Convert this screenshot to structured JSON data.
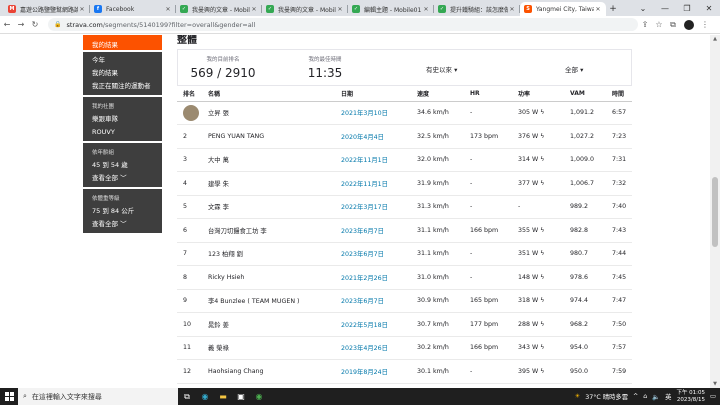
{
  "browser": {
    "tabs": [
      {
        "title": "嘉遊公路鹽鹽幫網路論...",
        "fav": "M",
        "color": "#ea4335",
        "active": false
      },
      {
        "title": "Facebook",
        "fav": "f",
        "color": "#1877f2",
        "active": false
      },
      {
        "title": "我曼興的文章 - Mobile01",
        "fav": "✓",
        "color": "#34a853",
        "active": false
      },
      {
        "title": "我曼興的文章 - Mobile01",
        "fav": "✓",
        "color": "#34a853",
        "active": false
      },
      {
        "title": "編輯主題 - Mobile01",
        "fav": "✓",
        "color": "#34a853",
        "active": false
      },
      {
        "title": "提升鐵騎組：該怎麼做...",
        "fav": "✓",
        "color": "#34a853",
        "active": false
      },
      {
        "title": "Yangmei City, Taiwan ...",
        "fav": "S",
        "color": "#fc5200",
        "active": true
      }
    ],
    "url_host": "strava.com",
    "url_path": "/segments/5140199?filter=overall&gender=all"
  },
  "sidebar": {
    "my_results": "我的結果",
    "sections": [
      {
        "items": [
          "今年",
          "我的結果",
          "我正在關注的運動者"
        ]
      },
      {
        "heading": "我的社團",
        "items": [
          "樂跟車隊",
          "ROUVY"
        ]
      },
      {
        "heading": "依年齡組",
        "items": [
          "45 到 54 歲",
          "查看全部 ﹀"
        ]
      },
      {
        "heading": "依體重等級",
        "items": [
          "75 到 84 公斤",
          "查看全部 ﹀"
        ]
      }
    ]
  },
  "main": {
    "title": "整體",
    "stats": {
      "rank_label": "我的目前排名",
      "rank_value": "569 / 2910",
      "best_label": "我的最佳時間",
      "best_value": "11:35"
    },
    "filter_time": "有史以來 ▾",
    "filter_gender": "全部 ▾"
  },
  "table": {
    "headers": [
      "排名",
      "名稱",
      "日期",
      "速度",
      "HR",
      "功率",
      "VAM",
      "時間"
    ],
    "rows": [
      {
        "rank": "",
        "name": "立昇 張",
        "date": "2021年3月10日",
        "speed": "34.6 km/h",
        "hr": "-",
        "power": "305 W ϟ",
        "vam": "1,091.2",
        "time": "6:57"
      },
      {
        "rank": "2",
        "name": "PENG YUAN TANG",
        "date": "2020年4月4日",
        "speed": "32.5 km/h",
        "hr": "173 bpm",
        "power": "376 W ϟ",
        "vam": "1,027.2",
        "time": "7:23"
      },
      {
        "rank": "3",
        "name": "大中 萬",
        "date": "2022年11月1日",
        "speed": "32.0 km/h",
        "hr": "-",
        "power": "314 W ϟ",
        "vam": "1,009.0",
        "time": "7:31"
      },
      {
        "rank": "4",
        "name": "建學 朱",
        "date": "2022年11月1日",
        "speed": "31.9 km/h",
        "hr": "-",
        "power": "377 W ϟ",
        "vam": "1,006.7",
        "time": "7:32"
      },
      {
        "rank": "5",
        "name": "文霖 李",
        "date": "2022年3月17日",
        "speed": "31.3 km/h",
        "hr": "-",
        "power": "-",
        "vam": "989.2",
        "time": "7:40"
      },
      {
        "rank": "6",
        "name": "台灣刀切饅食工坊 李",
        "date": "2023年6月7日",
        "speed": "31.1 km/h",
        "hr": "166 bpm",
        "power": "355 W ϟ",
        "vam": "982.8",
        "time": "7:43"
      },
      {
        "rank": "7",
        "name": "123 柏翔 劉",
        "date": "2023年6月7日",
        "speed": "31.1 km/h",
        "hr": "-",
        "power": "351 W ϟ",
        "vam": "980.7",
        "time": "7:44"
      },
      {
        "rank": "8",
        "name": "Ricky Hsieh",
        "date": "2021年2月26日",
        "speed": "31.0 km/h",
        "hr": "-",
        "power": "148 W ϟ",
        "vam": "978.6",
        "time": "7:45"
      },
      {
        "rank": "9",
        "name": "李4 Bunzlee ( TEAM MUGEN )",
        "date": "2023年6月7日",
        "speed": "30.9 km/h",
        "hr": "165 bpm",
        "power": "318 W ϟ",
        "vam": "974.4",
        "time": "7:47"
      },
      {
        "rank": "10",
        "name": "晁鈴 姜",
        "date": "2022年5月18日",
        "speed": "30.7 km/h",
        "hr": "177 bpm",
        "power": "288 W ϟ",
        "vam": "968.2",
        "time": "7:50"
      },
      {
        "rank": "11",
        "name": "義 榮祿",
        "date": "2023年4月26日",
        "speed": "30.2 km/h",
        "hr": "166 bpm",
        "power": "343 W ϟ",
        "vam": "954.0",
        "time": "7:57"
      },
      {
        "rank": "12",
        "name": "Haohsiang Chang",
        "date": "2019年8月24日",
        "speed": "30.1 km/h",
        "hr": "-",
        "power": "395 W ϟ",
        "vam": "950.0",
        "time": "7:59"
      }
    ]
  },
  "taskbar": {
    "search_placeholder": "在這裡輸入文字來搜尋",
    "weather": "37°C 晴時多雲",
    "ime": "英",
    "time": "下午 01:05",
    "date": "2023/8/15"
  }
}
